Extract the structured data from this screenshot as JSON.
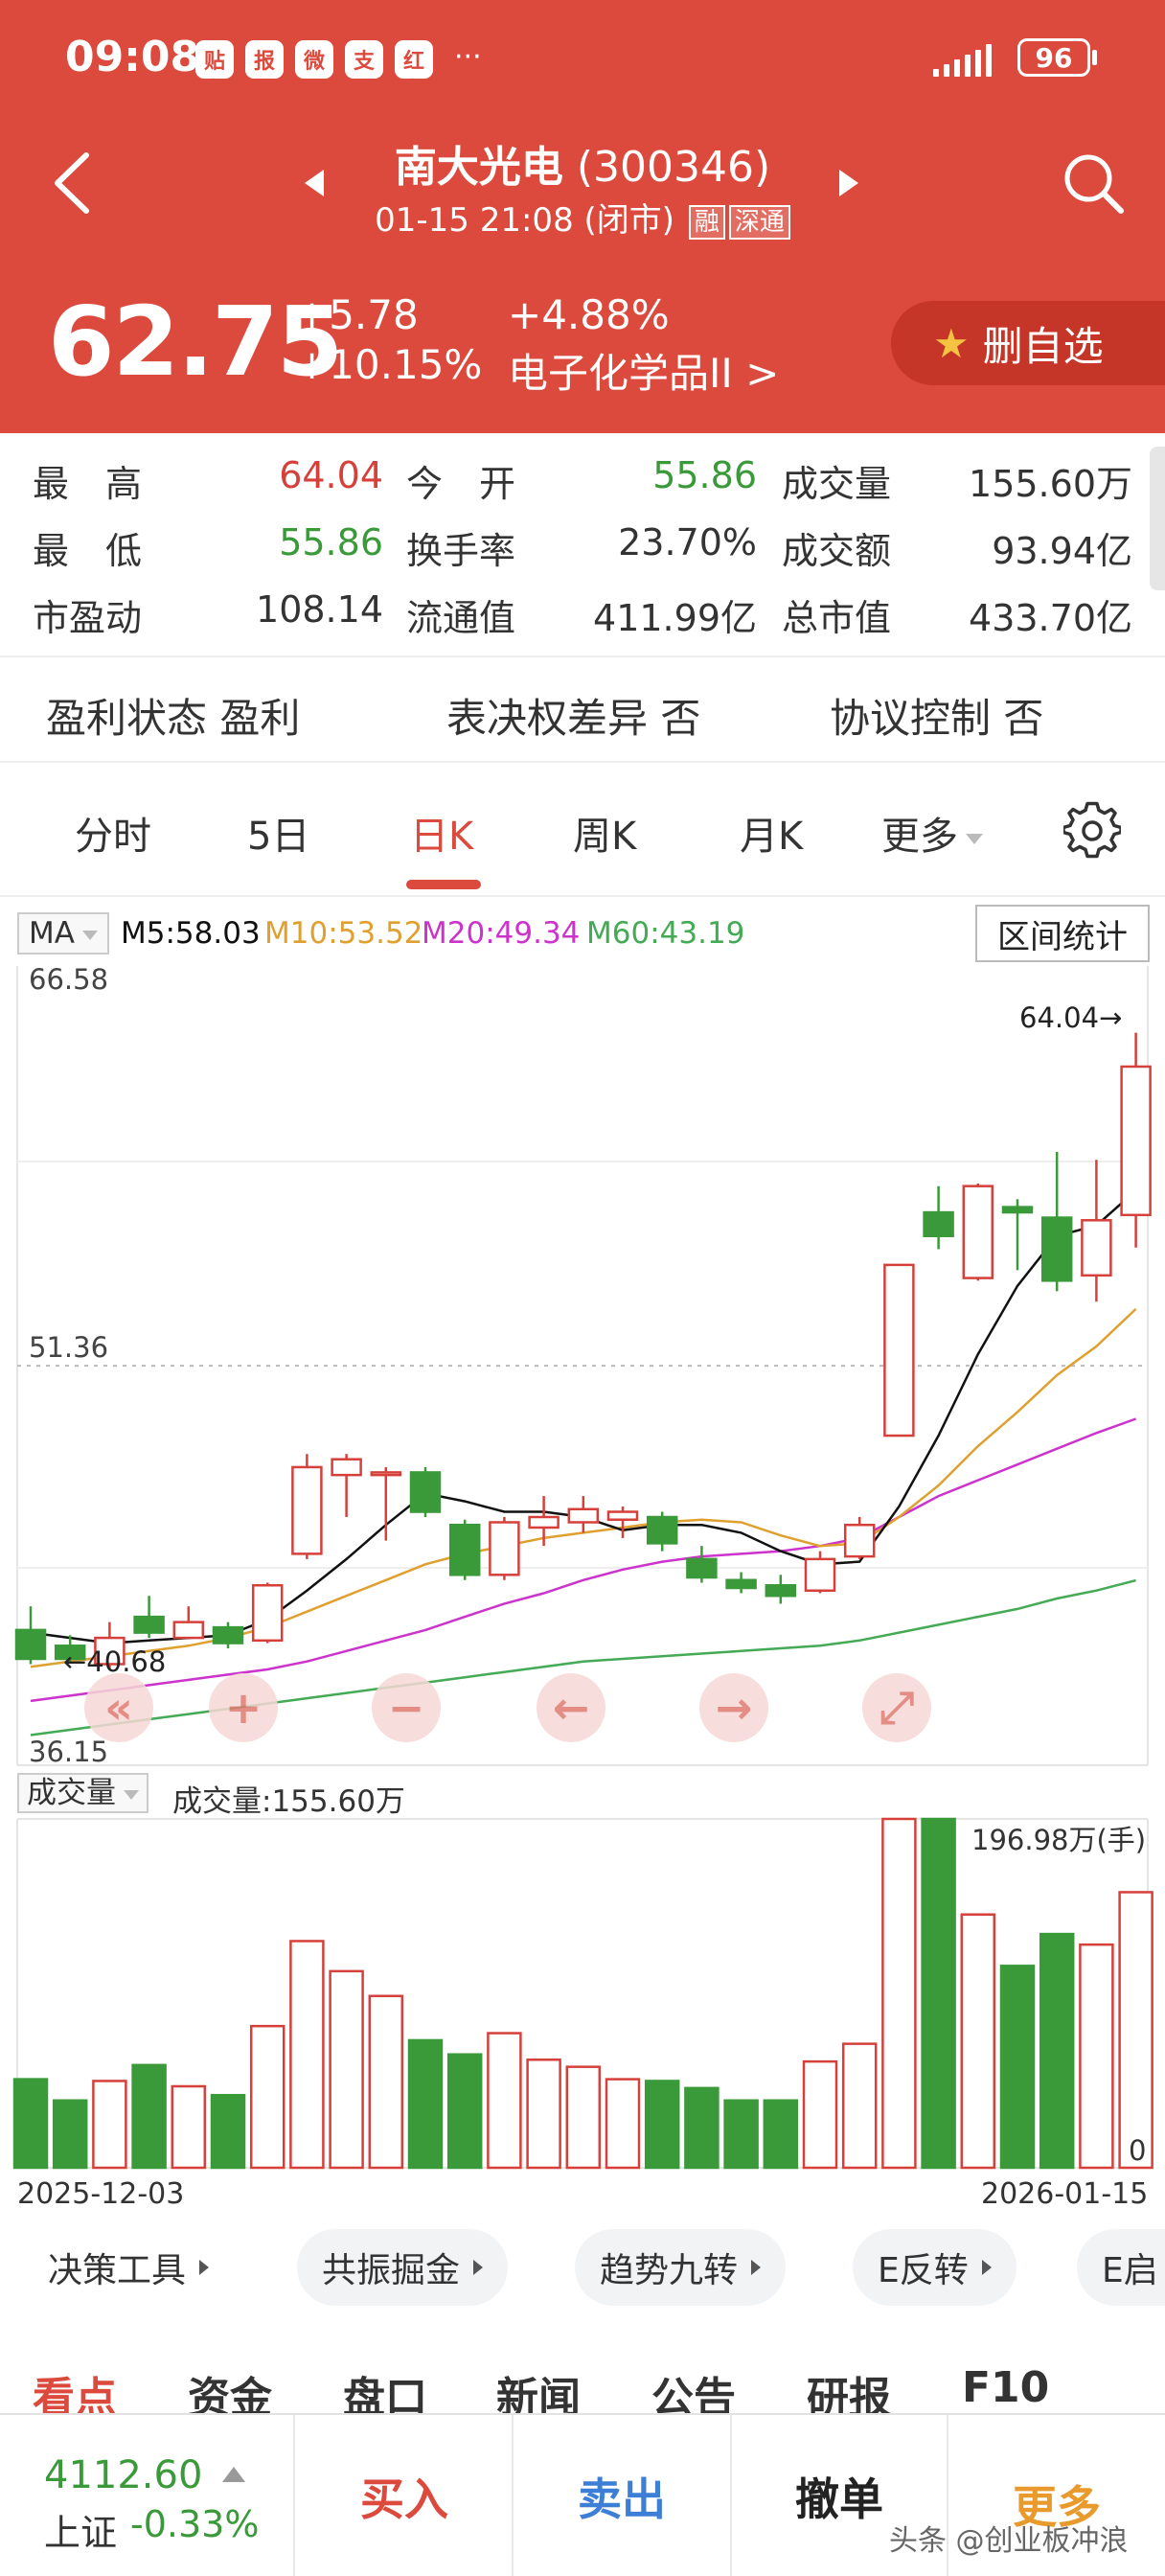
{
  "status_bar": {
    "time": "09:08",
    "app_icons": [
      "贴",
      "报",
      "微",
      "支",
      "红"
    ],
    "more": "···",
    "battery": "96"
  },
  "stock": {
    "name": "南大光电",
    "code": "(300346)",
    "datetime": "01-15 21:08",
    "status": "(闭市)",
    "tag_margin": "融",
    "tag_exchange": "深通",
    "price": "62.75",
    "change_abs": "+5.78",
    "change_pct": "+10.15%",
    "sector_pct": "+4.88%",
    "sector_name": "电子化学品II >",
    "watch_label": "删自选"
  },
  "quotes": {
    "row1": [
      {
        "label": "最　高",
        "value": "64.04"
      },
      {
        "label": "今　开",
        "value": "55.86"
      },
      {
        "label": "成交量",
        "value": "155.60万"
      }
    ],
    "row2": [
      {
        "label": "最　低",
        "value": "55.86"
      },
      {
        "label": "换手率",
        "value": "23.70%"
      },
      {
        "label": "成交额",
        "value": "93.94亿"
      }
    ],
    "row3": [
      {
        "label": "市盈动",
        "value": "108.14"
      },
      {
        "label": "流通值",
        "value": "411.99亿"
      },
      {
        "label": "总市值",
        "value": "433.70亿"
      }
    ]
  },
  "info": {
    "profit_state": "盈利状态 盈利",
    "vote_diff": "表决权差异 否",
    "agreement": "协议控制 否"
  },
  "tabs": [
    "分时",
    "5日",
    "日K",
    "周K",
    "月K",
    "更多"
  ],
  "ma": {
    "select": "MA",
    "m5": "M5:58.03",
    "m10": "M10:53.52",
    "m20": "M20:49.34",
    "m60": "M60:43.19",
    "range_stats": "区间统计"
  },
  "colors": {
    "up": "#d6403a",
    "down": "#3a9a3a",
    "m5": "#111111",
    "m10": "#e0a030",
    "m20": "#cc33cc",
    "m60": "#44aa55",
    "header": "#db4a3c"
  },
  "controls": [
    "«",
    "+",
    "−",
    "←",
    "→",
    "⤢"
  ],
  "chart_data": {
    "type": "candlestick",
    "y_axis_labels": [
      "66.58",
      "51.36",
      "36.15"
    ],
    "ylim": [
      36.15,
      66.58
    ],
    "high_marker": "64.04→",
    "low_marker": "←40.68",
    "candles": [
      {
        "open": 41.3,
        "high": 42.2,
        "low": 40.0,
        "close": 40.2
      },
      {
        "open": 40.7,
        "high": 41.1,
        "low": 40.1,
        "close": 40.2
      },
      {
        "open": 40.0,
        "high": 41.6,
        "low": 39.8,
        "close": 41.0
      },
      {
        "open": 41.8,
        "high": 42.6,
        "low": 41.0,
        "close": 41.2
      },
      {
        "open": 41.0,
        "high": 42.2,
        "low": 41.0,
        "close": 41.6
      },
      {
        "open": 41.4,
        "high": 41.6,
        "low": 40.6,
        "close": 40.8
      },
      {
        "open": 40.9,
        "high": 43.1,
        "low": 40.8,
        "close": 43.0
      },
      {
        "open": 44.2,
        "high": 48.0,
        "low": 44.0,
        "close": 47.5
      },
      {
        "open": 47.2,
        "high": 48.0,
        "low": 45.6,
        "close": 47.8
      },
      {
        "open": 47.2,
        "high": 47.5,
        "low": 44.7,
        "close": 47.3
      },
      {
        "open": 47.3,
        "high": 47.5,
        "low": 45.6,
        "close": 45.8
      },
      {
        "open": 45.3,
        "high": 45.5,
        "low": 43.2,
        "close": 43.4
      },
      {
        "open": 43.4,
        "high": 45.6,
        "low": 43.2,
        "close": 45.4
      },
      {
        "open": 45.2,
        "high": 46.4,
        "low": 44.5,
        "close": 45.6
      },
      {
        "open": 45.4,
        "high": 46.4,
        "low": 45.0,
        "close": 45.9
      },
      {
        "open": 45.5,
        "high": 46.0,
        "low": 44.8,
        "close": 45.8
      },
      {
        "open": 45.6,
        "high": 45.8,
        "low": 44.3,
        "close": 44.6
      },
      {
        "open": 44.0,
        "high": 44.5,
        "low": 43.1,
        "close": 43.3
      },
      {
        "open": 43.2,
        "high": 43.5,
        "low": 42.7,
        "close": 42.9
      },
      {
        "open": 43.0,
        "high": 43.4,
        "low": 42.3,
        "close": 42.6
      },
      {
        "open": 42.8,
        "high": 44.3,
        "low": 42.7,
        "close": 44.0
      },
      {
        "open": 44.1,
        "high": 45.6,
        "low": 44.0,
        "close": 45.3
      },
      {
        "open": 48.7,
        "high": 55.2,
        "low": 48.7,
        "close": 55.2
      },
      {
        "open": 57.2,
        "high": 58.2,
        "low": 55.8,
        "close": 56.3
      },
      {
        "open": 54.7,
        "high": 58.3,
        "low": 54.6,
        "close": 58.2
      },
      {
        "open": 57.4,
        "high": 57.7,
        "low": 55.0,
        "close": 57.2
      },
      {
        "open": 57.0,
        "high": 59.5,
        "low": 54.2,
        "close": 54.6
      },
      {
        "open": 54.8,
        "high": 59.2,
        "low": 53.8,
        "close": 56.9
      },
      {
        "open": 57.1,
        "high": 64.04,
        "low": 55.86,
        "close": 62.75
      }
    ],
    "ma5": [
      41.2,
      41.0,
      40.8,
      40.9,
      41.0,
      41.1,
      41.7,
      42.8,
      44.0,
      45.3,
      46.5,
      46.2,
      45.8,
      45.8,
      45.6,
      45.1,
      45.3,
      45.3,
      45.0,
      44.3,
      43.8,
      43.9,
      46.0,
      48.7,
      51.8,
      54.4,
      56.3,
      56.7,
      58.03
    ],
    "ma10": [
      39.9,
      40.1,
      40.3,
      40.5,
      40.7,
      41.0,
      41.4,
      42.0,
      42.6,
      43.2,
      43.8,
      44.2,
      44.5,
      44.8,
      45.0,
      45.2,
      45.4,
      45.5,
      45.4,
      44.9,
      44.5,
      44.6,
      45.6,
      46.8,
      48.3,
      49.6,
      51.0,
      52.1,
      53.52
    ],
    "ma20": [
      38.6,
      38.8,
      39.0,
      39.2,
      39.4,
      39.6,
      39.8,
      40.1,
      40.5,
      40.9,
      41.3,
      41.8,
      42.3,
      42.7,
      43.2,
      43.6,
      43.9,
      44.1,
      44.2,
      44.3,
      44.5,
      44.8,
      45.6,
      46.4,
      47.0,
      47.6,
      48.2,
      48.8,
      49.34
    ],
    "ma60": [
      37.3,
      37.5,
      37.7,
      37.9,
      38.1,
      38.3,
      38.5,
      38.7,
      38.9,
      39.1,
      39.3,
      39.5,
      39.7,
      39.9,
      40.1,
      40.2,
      40.3,
      40.4,
      40.5,
      40.6,
      40.7,
      40.9,
      41.2,
      41.5,
      41.8,
      42.1,
      42.5,
      42.8,
      43.19
    ],
    "volume": {
      "label": "成交量",
      "current": "成交量:155.60万",
      "max_label": "196.98万(手)",
      "zero_label": "0",
      "max": 196.98,
      "values": [
        50,
        38,
        49,
        58,
        46,
        41,
        80,
        128,
        111,
        97,
        72,
        64,
        76,
        61,
        57,
        50,
        49,
        45,
        38,
        38,
        60,
        70,
        196.98,
        196.98,
        143,
        114,
        132,
        126,
        155.6
      ]
    },
    "dates": {
      "start": "2025-12-03",
      "end": "2026-01-15"
    }
  },
  "tools": [
    "决策工具",
    "共振掘金",
    "趋势九转",
    "E反转",
    "E启"
  ],
  "content_tabs": [
    "看点",
    "资金",
    "盘口",
    "新闻",
    "公告",
    "研报",
    "F10"
  ],
  "bottom": {
    "index_value": "4112.60",
    "index_name": "上证",
    "index_change": "-0.33%",
    "buy": "买入",
    "sell": "卖出",
    "cancel": "撤单",
    "more": "更多"
  },
  "watermark": "头条 @创业板冲浪"
}
